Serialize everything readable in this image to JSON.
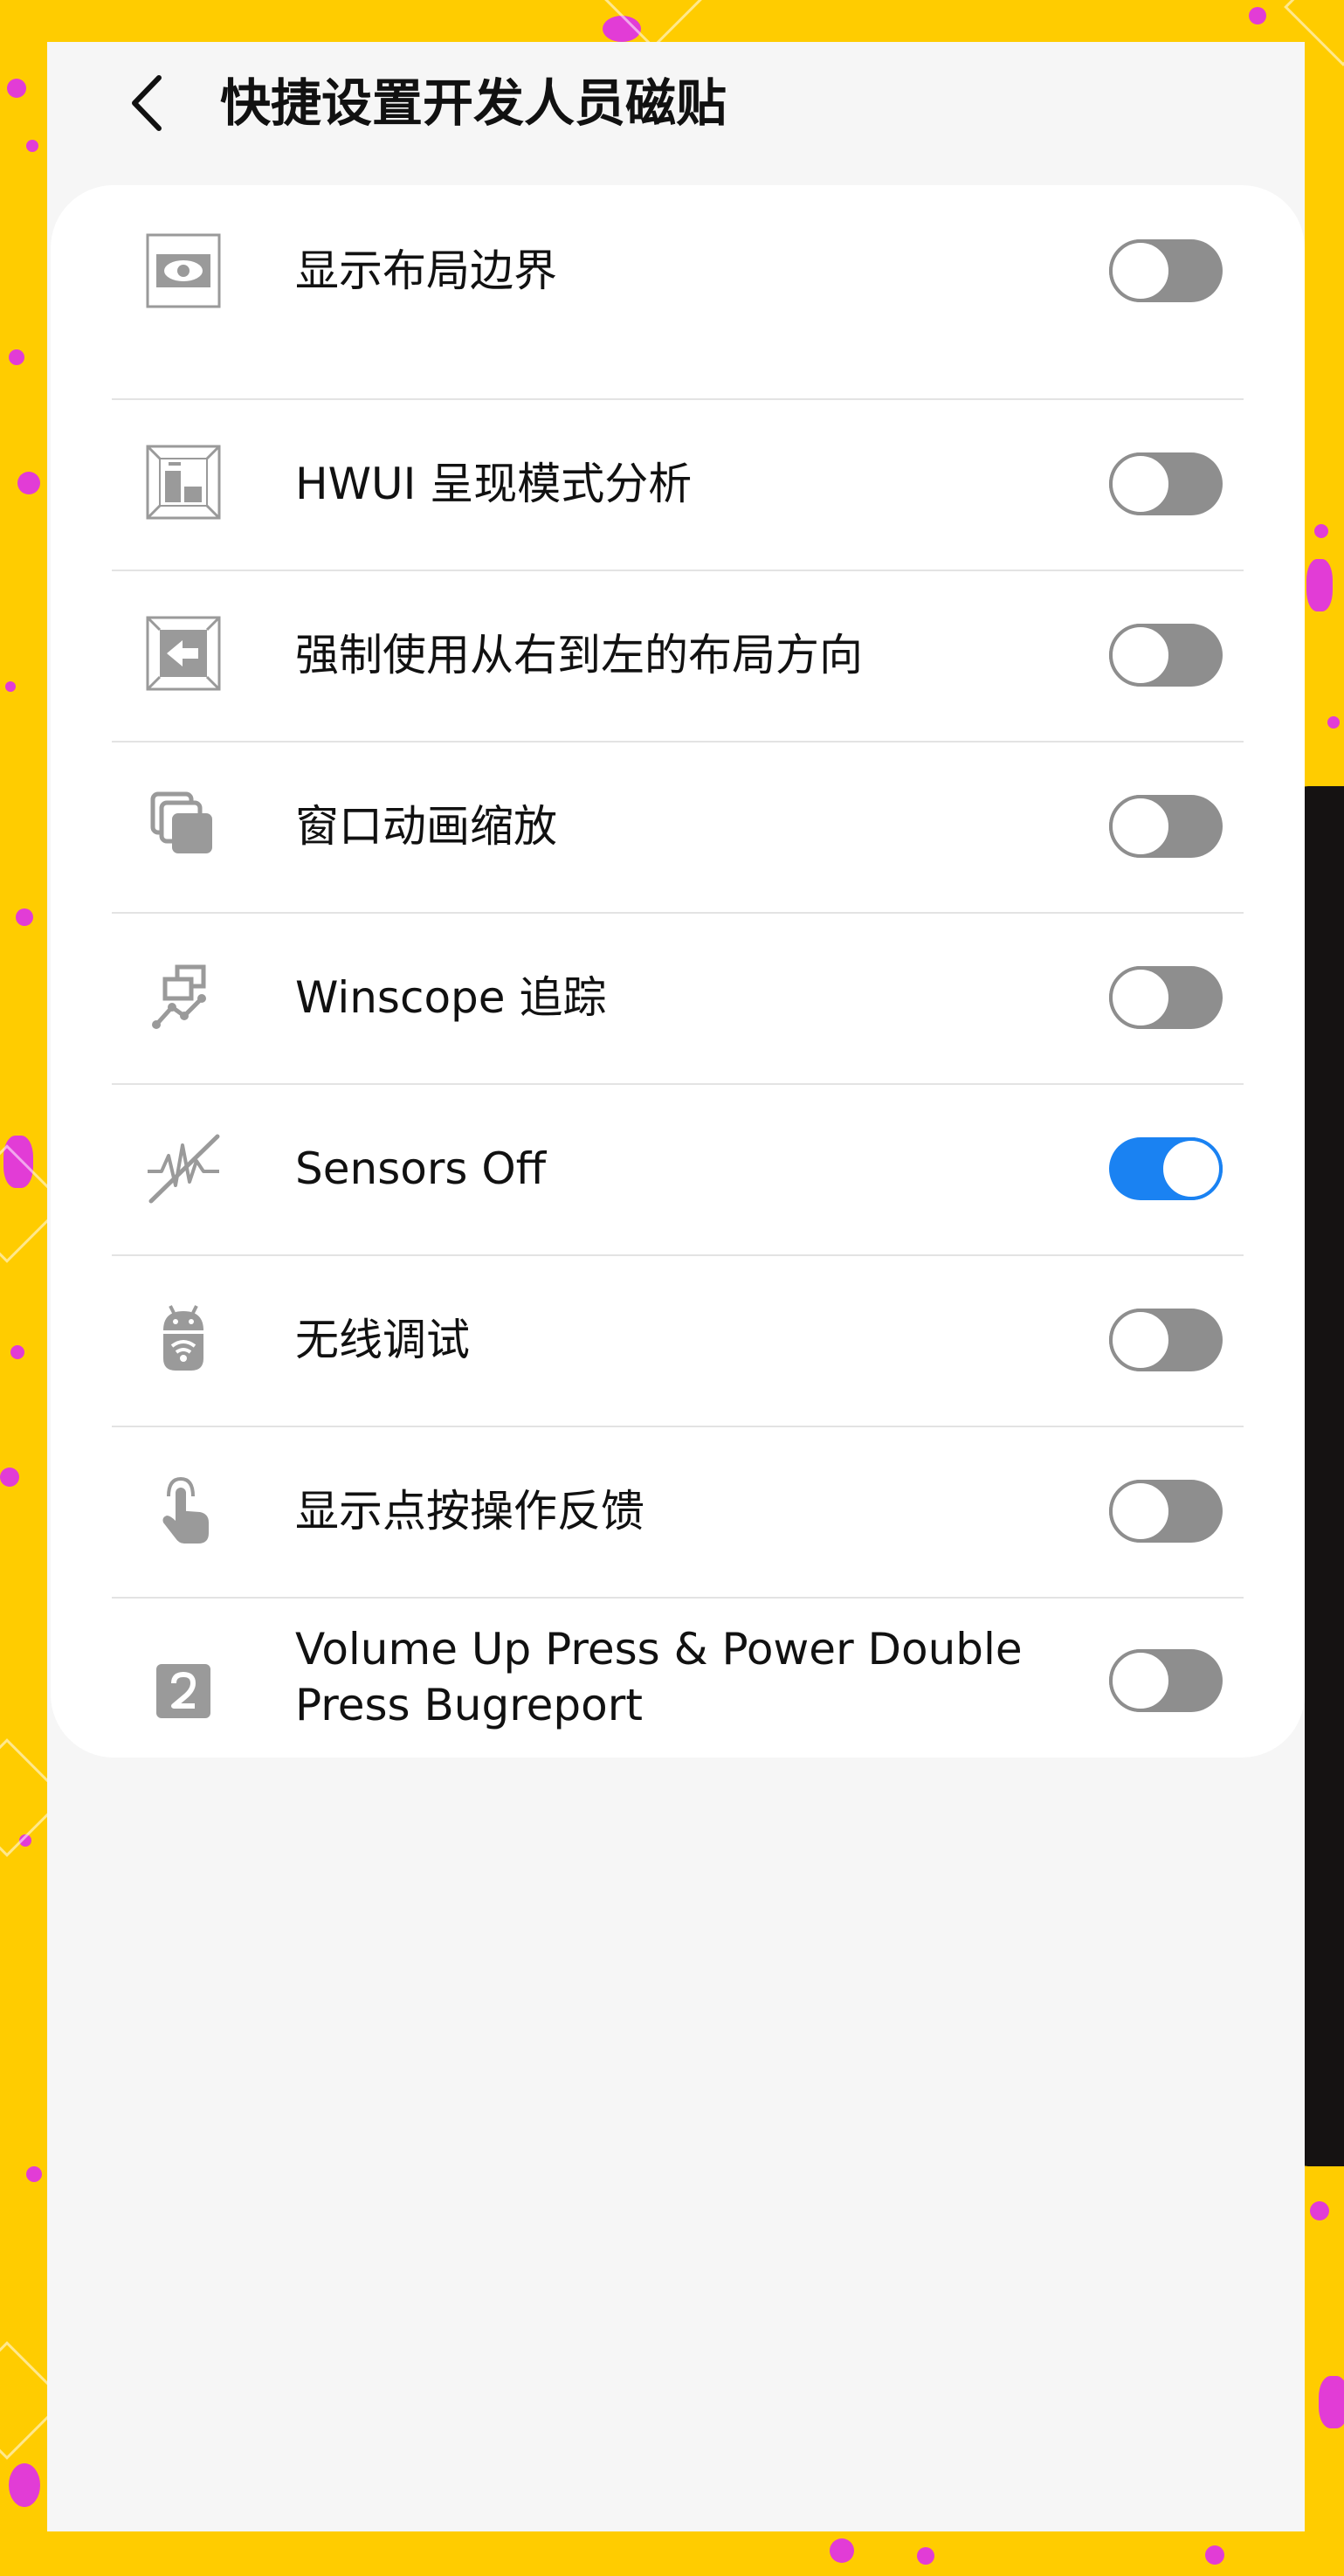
{
  "header": {
    "title": "快捷设置开发人员磁贴",
    "back_icon": "chevron-left-icon"
  },
  "tiles": [
    {
      "label": "显示布局边界",
      "icon": "eye-bounds-icon",
      "enabled": false
    },
    {
      "label": "HWUI 呈现模式分析",
      "icon": "bar-chart-icon",
      "enabled": false
    },
    {
      "label": "强制使用从右到左的布局方向",
      "icon": "arrow-left-box-icon",
      "enabled": false
    },
    {
      "label": "窗口动画缩放",
      "icon": "stacked-windows-icon",
      "enabled": false
    },
    {
      "label": "Winscope 追踪",
      "icon": "trace-graph-icon",
      "enabled": false
    },
    {
      "label": "Sensors Off",
      "icon": "sensors-off-icon",
      "enabled": true
    },
    {
      "label": "无线调试",
      "icon": "android-wifi-icon",
      "enabled": false
    },
    {
      "label": "显示点按操作反馈",
      "icon": "tap-finger-icon",
      "enabled": false
    },
    {
      "label": "Volume Up Press & Power Double Press Bugreport",
      "icon": "number-two-icon",
      "enabled": false
    }
  ],
  "colors": {
    "toggle_on": "#1a82f2",
    "toggle_off": "#8e8e8e",
    "icon_gray": "#8a8a8a",
    "background_yellow": "#ffcc00",
    "accent_magenta": "#e23cd6"
  }
}
